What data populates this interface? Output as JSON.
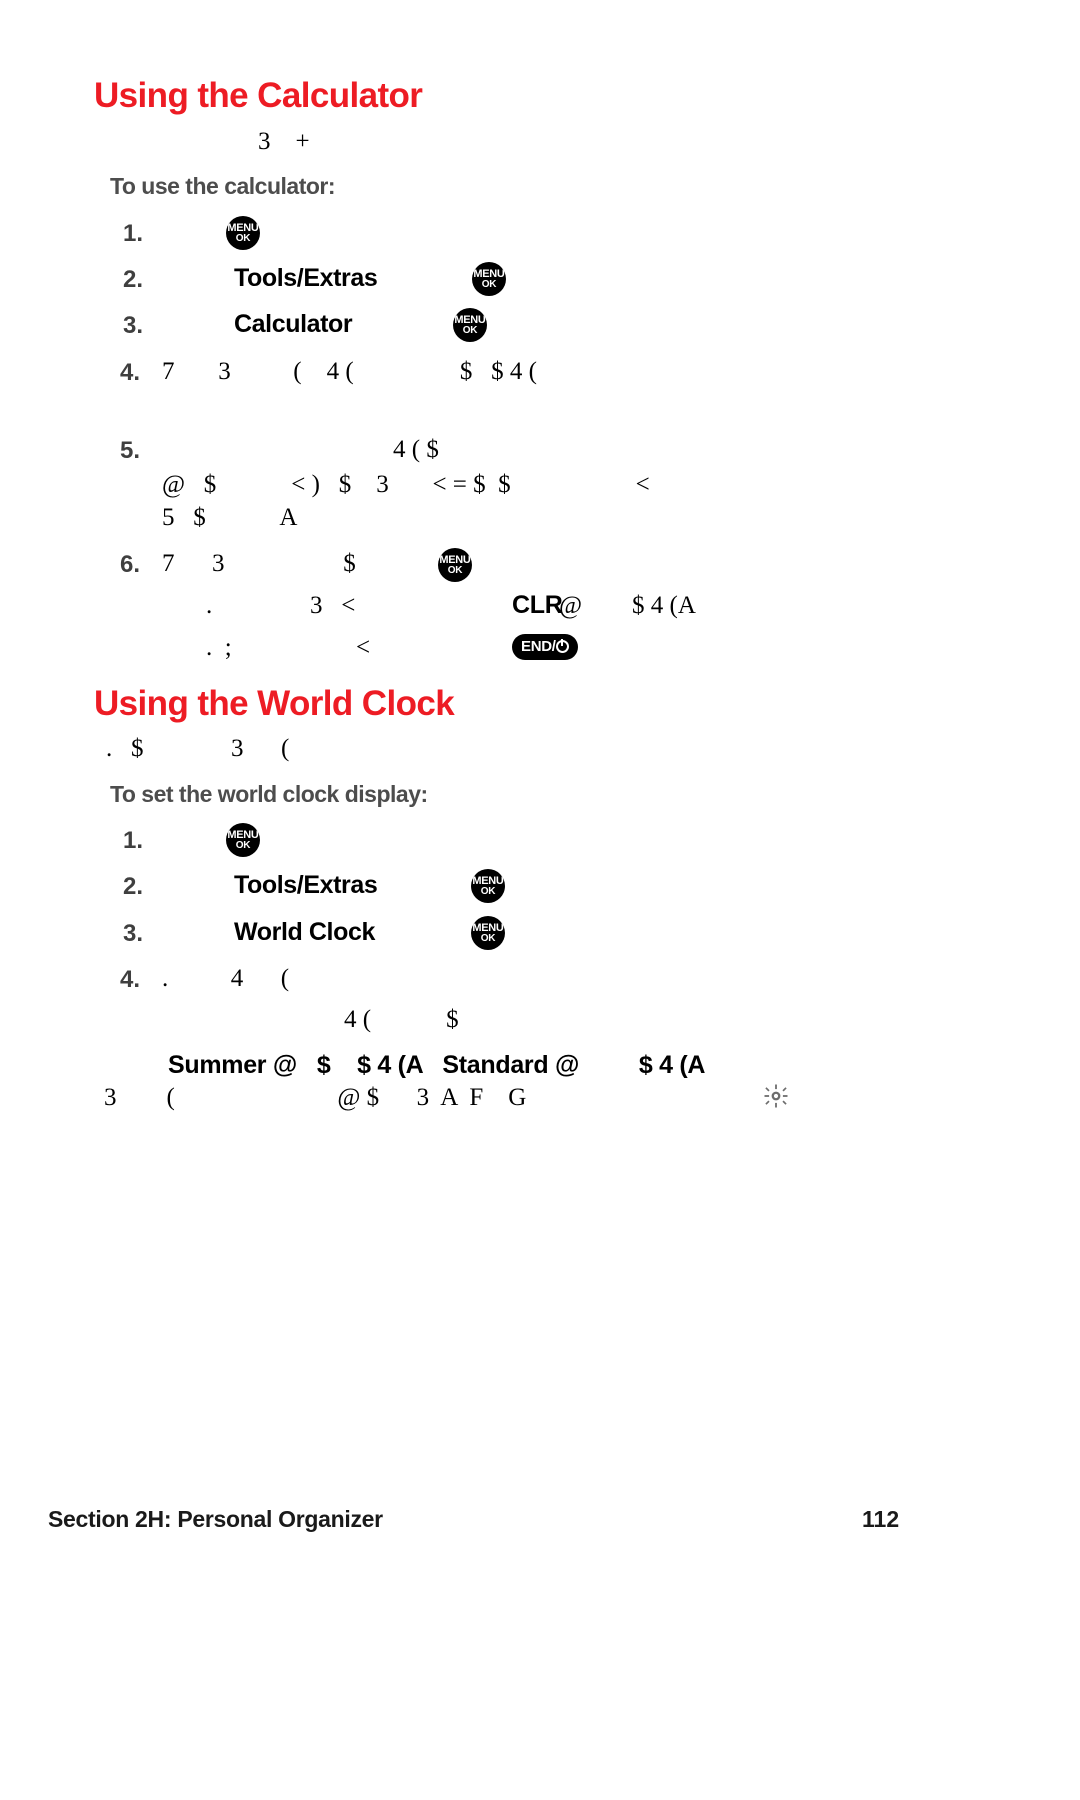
{
  "page": {
    "number": "112",
    "footer_section": "Section 2H: Personal Organizer",
    "accent_color": "#ed1c24",
    "subheading_color": "#4d4d4d",
    "background": "#ffffff"
  },
  "keys": {
    "menu_line1": "MENU",
    "menu_line2": "OK",
    "end_label": "END/",
    "clr_label": "CLR"
  },
  "sections": [
    {
      "title": "Using the Calculator",
      "intro": "3    +",
      "subheading": "To use the calculator:",
      "steps": [
        {
          "number": "1.",
          "text": ""
        },
        {
          "number": "2.",
          "text": "Tools/Extras"
        },
        {
          "number": "3.",
          "text": "Calculator"
        },
        {
          "number": "4.",
          "text": "7       3          (    4 (                 $   $ 4 ("
        },
        {
          "number": "5.",
          "text": "4 ( $"
        },
        {
          "number": "6.",
          "text": "7      3                   $"
        }
      ],
      "step5_lines": [
        "@   $            < )   $    3       < = $  $                    <",
        "5   $            A"
      ],
      "notes": [
        {
          "prefix": ".",
          "text": "3   <",
          "key": "CLR",
          "suffix": "@        $ 4 (A"
        },
        {
          "prefix": ".  ;",
          "text": "<",
          "key": "END",
          "suffix": ""
        }
      ]
    },
    {
      "title": "Using the World Clock",
      "intro": ".   $              3      (",
      "subheading": "To set the world clock display:",
      "steps": [
        {
          "number": "1.",
          "text": ""
        },
        {
          "number": "2.",
          "text": "Tools/Extras"
        },
        {
          "number": "3.",
          "text": "World Clock"
        },
        {
          "number": "4.",
          "text": ".          4      ("
        }
      ],
      "tail_lines": [
        "4 (            $",
        "Summer @   $    $ 4 (A   Standard @         $ 4 (A",
        "3        (                          @ $      3  A  F    G"
      ],
      "tail_bold_terms": [
        "Summer",
        "Standard"
      ]
    }
  ],
  "icons": {
    "note_starburst": "starburst-icon"
  }
}
